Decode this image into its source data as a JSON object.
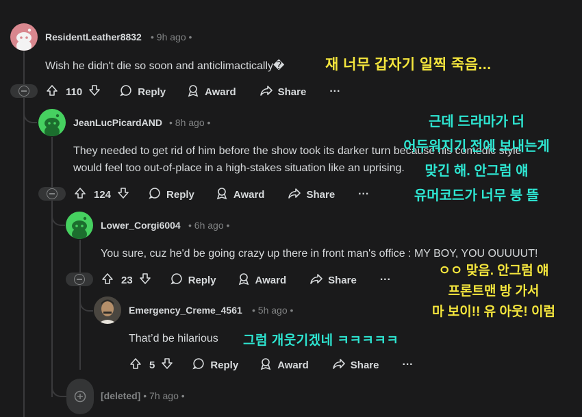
{
  "comments": [
    {
      "username": "ResidentLeather8832",
      "age": "9h ago",
      "text": "Wish he didn't die so soon and anticlimactically�",
      "votes": "110"
    },
    {
      "username": "JeanLucPicardAND",
      "age": "8h ago",
      "text_lines": [
        "They needed to get rid of him before the show took its darker turn because his comedic style",
        "would feel too out-of-place in a high-stakes situation like an uprising."
      ],
      "votes": "124"
    },
    {
      "username": "Lower_Corgi6004",
      "age": "6h ago",
      "text": "You sure, cuz he'd be going crazy up there in front man's office : MY BOY, YOU OUUUUT!",
      "votes": "23"
    },
    {
      "username": "Emergency_Creme_4561",
      "age": "5h ago",
      "text": "That’d be hilarious",
      "votes": "5"
    },
    {
      "username": "[deleted]",
      "age": "7h ago"
    }
  ],
  "actions": {
    "reply": "Reply",
    "award": "Award",
    "share": "Share",
    "more": "···"
  },
  "separator": "•",
  "overlays": {
    "c1": "재 너무 갑자기 일찍 죽음...",
    "c2": [
      "근데 드라마가 더",
      "어두워지기 전에 보내는게",
      "맞긴 해. 안그럼 얘",
      "유머코드가 너무 붕 뜰"
    ],
    "c3": [
      "ㅇㅇ 맞음. 안그럼 얘",
      "프론트맨 방 가서",
      "마 보이!! 유 아웃! 이럼"
    ],
    "c4": "그럼 개웃기겠네 ㅋㅋㅋㅋㅋ"
  },
  "colors": {
    "background": "#1a1a1b",
    "text": "#d7dadc",
    "muted": "#818384",
    "thread": "#3a3a3c",
    "yellow": "#f5e63d",
    "cyan": "#2ee6d2"
  }
}
